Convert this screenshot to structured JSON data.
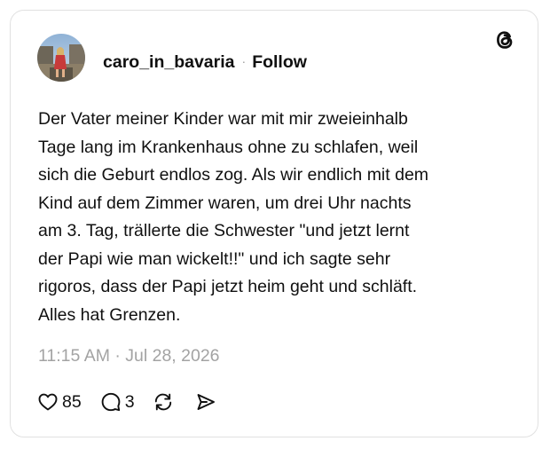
{
  "post": {
    "author": {
      "username": "caro_in_bavaria",
      "separator": "·",
      "follow_label": "Follow"
    },
    "logo_icon": "threads-logo-icon",
    "body_lines": [
      "Der Vater meiner Kinder war mit mir zweieinhalb",
      "Tage lang im Krankenhaus ohne zu schlafen, weil",
      "sich die Geburt endlos zog. Als wir endlich mit dem",
      "Kind auf dem Zimmer waren, um drei Uhr nachts",
      "am 3. Tag, trällerte die Schwester \"und jetzt lernt",
      "der Papi wie man wickelt!!\" und ich sagte sehr",
      "rigoros, dass der Papi jetzt heim geht und schläft.",
      "Alles hat Grenzen."
    ],
    "timestamp": "11:15 AM · Jul 28, 2026",
    "actions": {
      "like_icon": "heart-icon",
      "like_count": "85",
      "reply_icon": "comment-icon",
      "reply_count": "3",
      "repost_icon": "repost-icon",
      "share_icon": "send-icon"
    }
  },
  "colors": {
    "text": "#101010",
    "muted": "#a3a3a3",
    "border": "#e1e1e1",
    "background": "#ffffff"
  }
}
